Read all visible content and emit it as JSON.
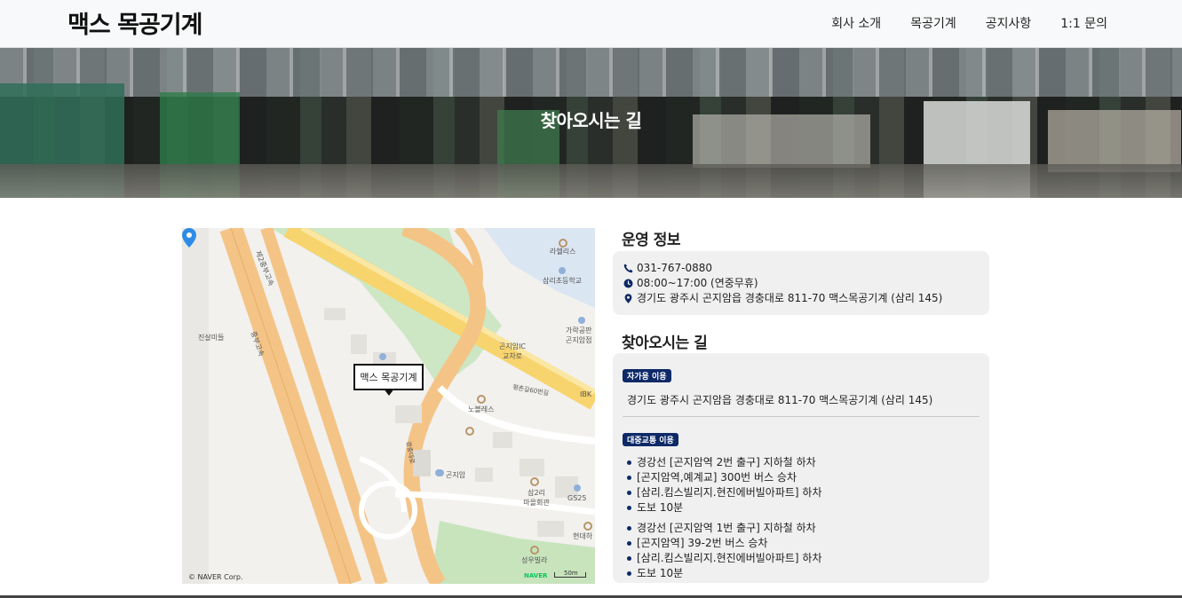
{
  "header": {
    "logo": "맥스 목공기계",
    "nav": [
      "회사 소개",
      "목공기계",
      "공지사항",
      "1:1 문의"
    ]
  },
  "hero": {
    "title": "찾아오시는 길"
  },
  "map": {
    "marker_label": "맥스 목공기계",
    "labels": {
      "road1": "제2중부고속",
      "road2": "중부고속",
      "place1": "라헬리스",
      "place2": "삼리초등학교",
      "place3": "진살미들",
      "place4": "곤지암IC\n교차로",
      "place5": "가락공판\n곤지암점",
      "place6": "노블레스",
      "place7": "평촌길60번길",
      "place8": "곤지암",
      "place9": "삼2리\n마을회관",
      "place10": "GS25",
      "place11": "현대하",
      "place12": "성우빌라",
      "place13": "IBK",
      "place14": "경충대로"
    },
    "copyright": "© NAVER Corp.",
    "brand": "NAVER",
    "scale": "50m"
  },
  "operation": {
    "title": "운영 정보",
    "phone": "031-767-0880",
    "hours": "08:00~17:00 (연중무휴)",
    "address": "경기도 광주시 곤지암읍 경충대로 811-70 맥스목공기계 (삼리 145)"
  },
  "directions": {
    "title": "찾아오시는 길",
    "car_badge": "자가용 이용",
    "car_address": "경기도 광주시 곤지암읍 경충대로 811-70 맥스목공기계 (삼리 145)",
    "transit_badge": "대중교통 이용",
    "route1": [
      "경강선 [곤지암역 2번 출구] 지하철 하차",
      "[곤지암역,예계교] 300번 버스 승차",
      "[삼리.킴스빌리지.현진에버빌아파트] 하차",
      "도보 10분"
    ],
    "route2": [
      "경강선 [곤지암역 1번 출구] 지하철 하차",
      "[곤지암역] 39-2번 버스 승차",
      "[삼리.킴스빌리지.현진에버빌아파트] 하차",
      "도보 10분"
    ]
  }
}
